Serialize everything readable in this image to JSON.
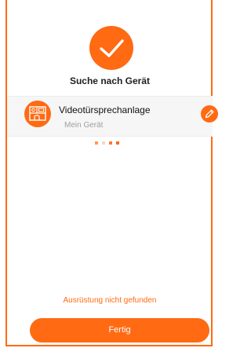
{
  "header": {
    "title": "Suche nach Gerät"
  },
  "device": {
    "name": "Videotürsprechanlage",
    "subtitle": "Mein Gerät",
    "icon": "intercom-icon"
  },
  "icons": {
    "success": "checkmark-icon",
    "edit": "pencil-icon"
  },
  "status": {
    "message": "Ausrüstung nicht gefunden"
  },
  "actions": {
    "done_label": "Fertig"
  },
  "colors": {
    "accent": "#ff6a13",
    "card_bg": "#f6f6f6",
    "muted_text": "#a0a0a0"
  }
}
